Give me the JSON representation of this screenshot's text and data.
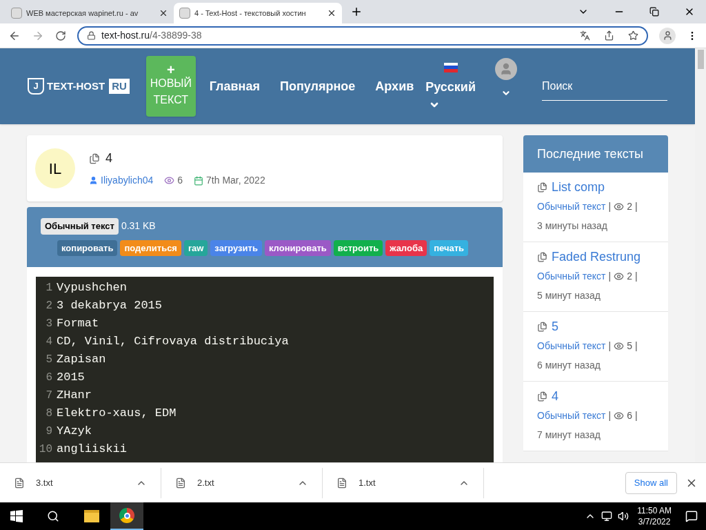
{
  "browser": {
    "tabs": [
      {
        "title": "WEB мастерская wapinet.ru - av",
        "selected": false
      },
      {
        "title": "4 - Text-Host - текстовый хостин",
        "selected": true
      }
    ],
    "url_host": "text-host.ru",
    "url_path": "/4-38899-38"
  },
  "header": {
    "logo_mark": "J",
    "logo_text": "TEXT-HOST",
    "logo_suffix": "RU",
    "new_button": {
      "icon": "+",
      "lines": [
        "НОВЫЙ",
        "ТЕКСТ"
      ]
    },
    "nav": [
      "Главная",
      "Популярное",
      "Архив"
    ],
    "language": "Русский",
    "search": {
      "placeholder": "Поиск"
    }
  },
  "paste": {
    "avatar": "IL",
    "title": "4",
    "author": "Iliyabylich04",
    "views": "6",
    "date": "7th Mar, 2022",
    "syntax": "Обычный текст",
    "size": "0.31 KB",
    "actions": [
      {
        "label": "копировать",
        "color": "#3f6f96"
      },
      {
        "label": "поделиться",
        "color": "#f28c1a"
      },
      {
        "label": "raw",
        "color": "#26a69a"
      },
      {
        "label": "загрузить",
        "color": "#4a84e8"
      },
      {
        "label": "клонировать",
        "color": "#9b59c6"
      },
      {
        "label": "встроить",
        "color": "#12b04c"
      },
      {
        "label": "жалоба",
        "color": "#e8344a"
      },
      {
        "label": "печать",
        "color": "#35b1e0"
      }
    ],
    "lines": [
      {
        "number": "1",
        "text": "Vypushchen"
      },
      {
        "number": "2",
        "text": "3 dekabrya 2015"
      },
      {
        "number": "3",
        "text": "Format"
      },
      {
        "number": "4",
        "text": "CD, Vinil, Cifrovaya distribuciya"
      },
      {
        "number": "5",
        "text": "Zapisan"
      },
      {
        "number": "6",
        "text": "2015"
      },
      {
        "number": "7",
        "text": "ZHanr"
      },
      {
        "number": "8",
        "text": "Elektro-xaus, EDM"
      },
      {
        "number": "9",
        "text": "YAzyk"
      },
      {
        "number": "10",
        "text": "angliiskii"
      }
    ]
  },
  "sidebar": {
    "title": "Последние тексты",
    "items": [
      {
        "title": "List comp",
        "syntax": "Обычный текст",
        "separators": [
          "|",
          "|"
        ],
        "views": "2",
        "time": "3 минуты назад"
      },
      {
        "title": "Faded Restrung",
        "syntax": "Обычный текст",
        "separators": [
          "|",
          "|"
        ],
        "views": "2",
        "time": "5 минут назад"
      },
      {
        "title": "5",
        "syntax": "Обычный текст",
        "separators": [
          "|",
          "|"
        ],
        "views": "5",
        "time": "6 минут назад"
      },
      {
        "title": "4",
        "syntax": "Обычный текст",
        "separators": [
          "|",
          "|"
        ],
        "views": "6",
        "time": "7 минут назад"
      }
    ]
  },
  "downloads": {
    "files": [
      "3.txt",
      "2.txt",
      "1.txt"
    ],
    "show_all": "Show all"
  },
  "taskbar": {
    "time": "11:50 AM",
    "date": "3/7/2022"
  }
}
